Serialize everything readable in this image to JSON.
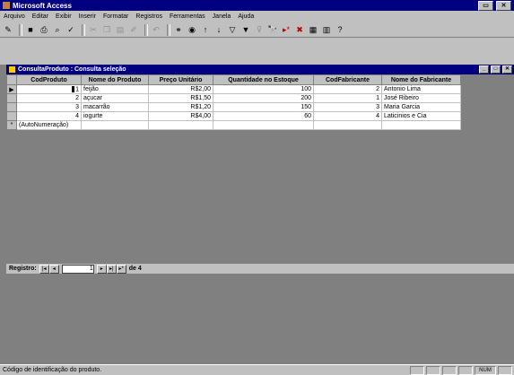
{
  "app": {
    "title": "Microsoft Access"
  },
  "menu": [
    "Arquivo",
    "Editar",
    "Exibir",
    "Inserir",
    "Formatar",
    "Registros",
    "Ferramentas",
    "Janela",
    "Ajuda"
  ],
  "window": {
    "title": "ConsultaProduto : Consulta seleção",
    "columns": [
      "CodProduto",
      "Nome do Produto",
      "Preço Unitário",
      "Quantidade no Estoque",
      "CodFabricante",
      "Nome do Fabricante"
    ],
    "rows": [
      {
        "cod": "1",
        "nome": "feijão",
        "preco": "R$2,00",
        "qtd": "100",
        "codfab": "2",
        "fab": "Antonio Lima"
      },
      {
        "cod": "2",
        "nome": "açucar",
        "preco": "R$1,50",
        "qtd": "200",
        "codfab": "1",
        "fab": "José Ribeiro"
      },
      {
        "cod": "3",
        "nome": "macarrão",
        "preco": "R$1,20",
        "qtd": "150",
        "codfab": "3",
        "fab": "Maria Garcia"
      },
      {
        "cod": "4",
        "nome": "iogurte",
        "preco": "R$4,00",
        "qtd": "60",
        "codfab": "4",
        "fab": "Laticinios e Cia"
      }
    ],
    "new_row": {
      "cod": "(AutoNumeração)"
    },
    "recordnav": {
      "label": "Registro:",
      "current": "1",
      "of_label": "de 4"
    }
  },
  "status": {
    "text": "Código de identificação do produto.",
    "mode": "NUM"
  }
}
